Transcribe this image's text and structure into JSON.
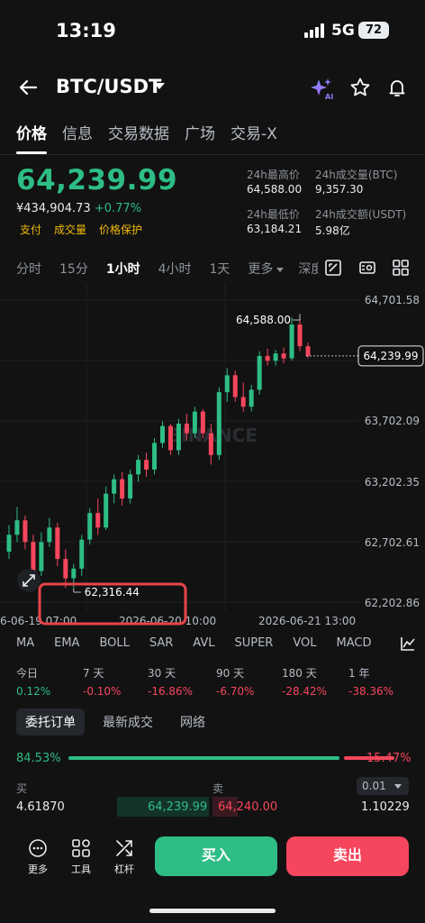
{
  "status": {
    "time": "13:19",
    "network": "5G",
    "battery": "72"
  },
  "header": {
    "pair": "BTC/USDT",
    "ai_badge": "AI"
  },
  "tabs": [
    {
      "label": "价格",
      "active": true
    },
    {
      "label": "信息",
      "active": false
    },
    {
      "label": "交易数据",
      "active": false
    },
    {
      "label": "广场",
      "active": false
    },
    {
      "label": "交易-X",
      "active": false
    }
  ],
  "price": {
    "last": "64,239.99",
    "fiat": "¥434,904.73",
    "change": "+0.77%",
    "tags": [
      "支付",
      "成交量",
      "价格保护"
    ]
  },
  "stats": {
    "high_label": "24h最高价",
    "high": "64,588.00",
    "vol_btc_label": "24h成交量(BTC)",
    "vol_btc": "9,357.30",
    "low_label": "24h最低价",
    "low": "63,184.21",
    "vol_usdt_label": "24h成交额(USDT)",
    "vol_usdt": "5.98亿"
  },
  "intervals": {
    "items": [
      "分时",
      "15分",
      "1小时",
      "4小时",
      "1天",
      "更多"
    ],
    "active": "1小时",
    "depth": "深度"
  },
  "chart_data": {
    "type": "candlestick",
    "interval": "1小时",
    "y_axis": [
      "64,701.58",
      "63,702.09",
      "63,202.35",
      "62,702.61",
      "62,202.86"
    ],
    "ylim": [
      62202.86,
      64701.58
    ],
    "x_axis": [
      "6-06-19 07:00",
      "2026-06-20 10:00",
      "2026-06-21 13:00"
    ],
    "current_price": "64,239.99",
    "high_marker": "64,588.00",
    "low_marker": "62,316.44",
    "watermark": "BINANCE",
    "candles": [
      [
        62620,
        62840,
        62560,
        62760
      ],
      [
        62760,
        62990,
        62700,
        62880
      ],
      [
        62880,
        62920,
        62640,
        62700
      ],
      [
        62700,
        62760,
        62380,
        62460
      ],
      [
        62460,
        62780,
        62420,
        62700
      ],
      [
        62700,
        62900,
        62660,
        62820
      ],
      [
        62820,
        62860,
        62500,
        62560
      ],
      [
        62560,
        62640,
        62320,
        62400
      ],
      [
        62400,
        62520,
        62316,
        62480
      ],
      [
        62480,
        62760,
        62420,
        62720
      ],
      [
        62720,
        62980,
        62680,
        62940
      ],
      [
        62940,
        63060,
        62760,
        62820
      ],
      [
        62820,
        63160,
        62800,
        63100
      ],
      [
        63100,
        63260,
        63020,
        63220
      ],
      [
        63220,
        63280,
        63000,
        63060
      ],
      [
        63060,
        63300,
        63020,
        63260
      ],
      [
        63260,
        63420,
        63200,
        63380
      ],
      [
        63380,
        63440,
        63240,
        63300
      ],
      [
        63300,
        63560,
        63260,
        63520
      ],
      [
        63520,
        63700,
        63480,
        63660
      ],
      [
        63660,
        63680,
        63420,
        63460
      ],
      [
        63460,
        63720,
        63420,
        63680
      ],
      [
        63680,
        63760,
        63540,
        63600
      ],
      [
        63600,
        63820,
        63560,
        63780
      ],
      [
        63780,
        63800,
        63560,
        63600
      ],
      [
        63600,
        63680,
        63340,
        63420
      ],
      [
        63420,
        63980,
        63380,
        63940
      ],
      [
        63940,
        64140,
        63860,
        64080
      ],
      [
        64080,
        64120,
        63860,
        63900
      ],
      [
        63900,
        64020,
        63780,
        63820
      ],
      [
        63820,
        64000,
        63780,
        63960
      ],
      [
        63960,
        64280,
        63920,
        64240
      ],
      [
        64240,
        64300,
        64160,
        64200
      ],
      [
        64200,
        64290,
        64160,
        64260
      ],
      [
        64260,
        64310,
        64180,
        64220
      ],
      [
        64220,
        64560,
        64200,
        64500
      ],
      [
        64500,
        64588,
        64280,
        64320
      ],
      [
        64320,
        64350,
        64220,
        64240
      ]
    ]
  },
  "indicators": [
    "MA",
    "EMA",
    "BOLL",
    "SAR",
    "AVL",
    "SUPER",
    "VOL",
    "MACD"
  ],
  "performance": [
    {
      "label": "今日",
      "value": "0.12%",
      "dir": "up"
    },
    {
      "label": "7 天",
      "value": "-0.10%",
      "dir": "down"
    },
    {
      "label": "30 天",
      "value": "-16.86%",
      "dir": "down"
    },
    {
      "label": "90 天",
      "value": "-6.70%",
      "dir": "down"
    },
    {
      "label": "180 天",
      "value": "-28.42%",
      "dir": "down"
    },
    {
      "label": "1 年",
      "value": "-38.36%",
      "dir": "down"
    }
  ],
  "orderbook": {
    "tabs": [
      "委托订单",
      "最新成交",
      "网络"
    ],
    "buy_ratio": "84.53%",
    "buy_ratio_value": 84.53,
    "sell_ratio": "15.47%",
    "buy_label": "买",
    "sell_label": "卖",
    "precision": "0.01",
    "rows": [
      {
        "bid_qty": "4.61870",
        "bid_price": "64,239.99",
        "ask_price": "64,240.00",
        "ask_qty": "1.10229"
      }
    ]
  },
  "bottom": {
    "more": "更多",
    "tools": "工具",
    "leverage": "杠杆",
    "buy": "买入",
    "sell": "卖出"
  },
  "colors": {
    "up": "#2ebd85",
    "down": "#f6465d",
    "accent": "#f0b90b",
    "bg": "#121212"
  }
}
